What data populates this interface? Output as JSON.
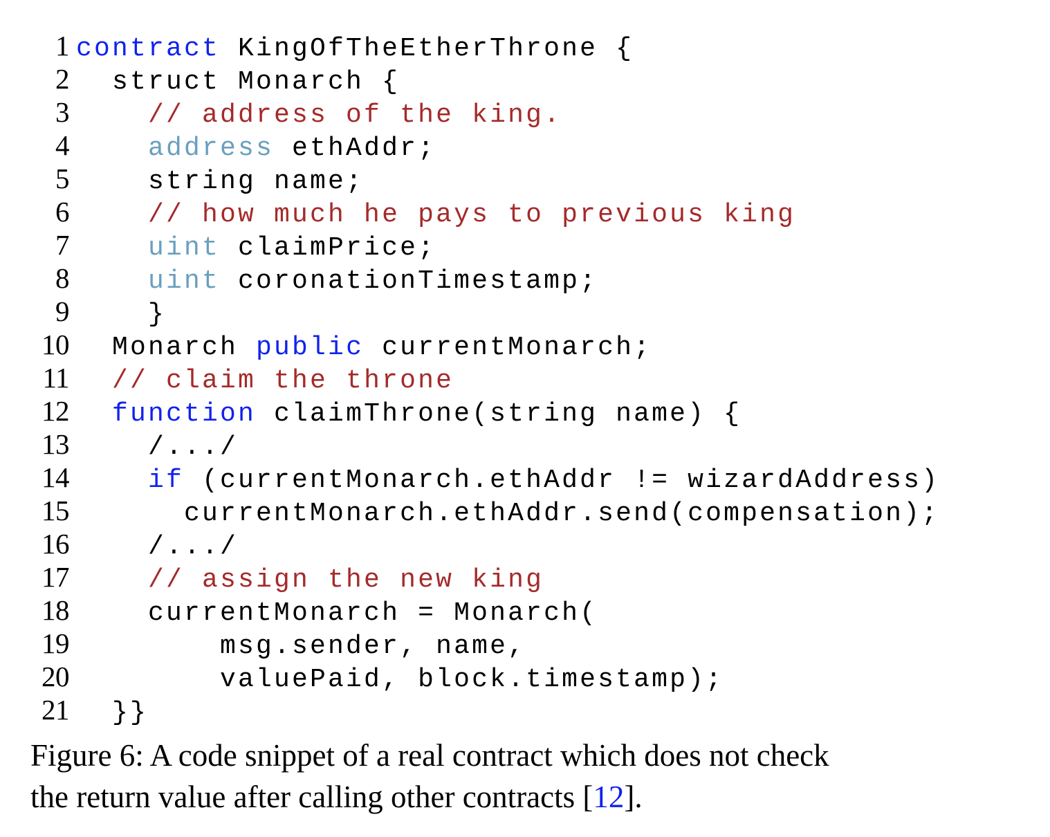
{
  "figure": {
    "colors": {
      "keyword": "#1122ee",
      "type": "#6a9fc0",
      "comment": "#a52a2a",
      "plain": "#000000",
      "background": "#ffffff",
      "citation_link": "#1122ee"
    },
    "code": {
      "language": "solidity",
      "first_line_number": 1,
      "last_line_number": 21,
      "lines": [
        {
          "n": "1",
          "tokens": [
            {
              "t": "contract",
              "c": "kw"
            },
            {
              "t": " KingOfTheEtherThrone {",
              "c": "plain"
            }
          ]
        },
        {
          "n": "2",
          "tokens": [
            {
              "t": "  struct Monarch {",
              "c": "plain"
            }
          ]
        },
        {
          "n": "3",
          "tokens": [
            {
              "t": "    ",
              "c": "plain"
            },
            {
              "t": "// address of the king.",
              "c": "cmt"
            }
          ]
        },
        {
          "n": "4",
          "tokens": [
            {
              "t": "    ",
              "c": "plain"
            },
            {
              "t": "address",
              "c": "typ"
            },
            {
              "t": " ethAddr;",
              "c": "plain"
            }
          ]
        },
        {
          "n": "5",
          "tokens": [
            {
              "t": "    string name;",
              "c": "plain"
            }
          ]
        },
        {
          "n": "6",
          "tokens": [
            {
              "t": "    ",
              "c": "plain"
            },
            {
              "t": "// how much he pays to previous king",
              "c": "cmt"
            }
          ]
        },
        {
          "n": "7",
          "tokens": [
            {
              "t": "    ",
              "c": "plain"
            },
            {
              "t": "uint",
              "c": "typ"
            },
            {
              "t": " claimPrice;",
              "c": "plain"
            }
          ]
        },
        {
          "n": "8",
          "tokens": [
            {
              "t": "    ",
              "c": "plain"
            },
            {
              "t": "uint",
              "c": "typ"
            },
            {
              "t": " coronationTimestamp;",
              "c": "plain"
            }
          ]
        },
        {
          "n": "9",
          "tokens": [
            {
              "t": "    }",
              "c": "plain"
            }
          ]
        },
        {
          "n": "10",
          "tokens": [
            {
              "t": "  Monarch ",
              "c": "plain"
            },
            {
              "t": "public",
              "c": "kw"
            },
            {
              "t": " currentMonarch;",
              "c": "plain"
            }
          ]
        },
        {
          "n": "11",
          "tokens": [
            {
              "t": "  ",
              "c": "plain"
            },
            {
              "t": "// claim the throne",
              "c": "cmt"
            }
          ]
        },
        {
          "n": "12",
          "tokens": [
            {
              "t": "  ",
              "c": "plain"
            },
            {
              "t": "function",
              "c": "kw"
            },
            {
              "t": " claimThrone(string name) {",
              "c": "plain"
            }
          ]
        },
        {
          "n": "13",
          "tokens": [
            {
              "t": "    /.../",
              "c": "plain"
            }
          ]
        },
        {
          "n": "14",
          "tokens": [
            {
              "t": "    ",
              "c": "plain"
            },
            {
              "t": "if",
              "c": "kw"
            },
            {
              "t": " (currentMonarch.ethAddr != wizardAddress)",
              "c": "plain"
            }
          ]
        },
        {
          "n": "15",
          "tokens": [
            {
              "t": "      currentMonarch.ethAddr.send(compensation);",
              "c": "plain"
            }
          ]
        },
        {
          "n": "16",
          "tokens": [
            {
              "t": "    /.../",
              "c": "plain"
            }
          ]
        },
        {
          "n": "17",
          "tokens": [
            {
              "t": "    ",
              "c": "plain"
            },
            {
              "t": "// assign the new king",
              "c": "cmt"
            }
          ]
        },
        {
          "n": "18",
          "tokens": [
            {
              "t": "    currentMonarch = Monarch(",
              "c": "plain"
            }
          ]
        },
        {
          "n": "19",
          "tokens": [
            {
              "t": "        msg.sender, name,",
              "c": "plain"
            }
          ]
        },
        {
          "n": "20",
          "tokens": [
            {
              "t": "        valuePaid, block.timestamp);",
              "c": "plain"
            }
          ]
        },
        {
          "n": "21",
          "tokens": [
            {
              "t": "  }}",
              "c": "plain"
            }
          ]
        }
      ]
    },
    "caption": {
      "label": "Figure 6:",
      "line1": "Figure 6: A code snippet of a real contract which does not check",
      "line2_before": "the return value after calling other contracts [",
      "citation": "12",
      "line2_after": "]."
    }
  }
}
